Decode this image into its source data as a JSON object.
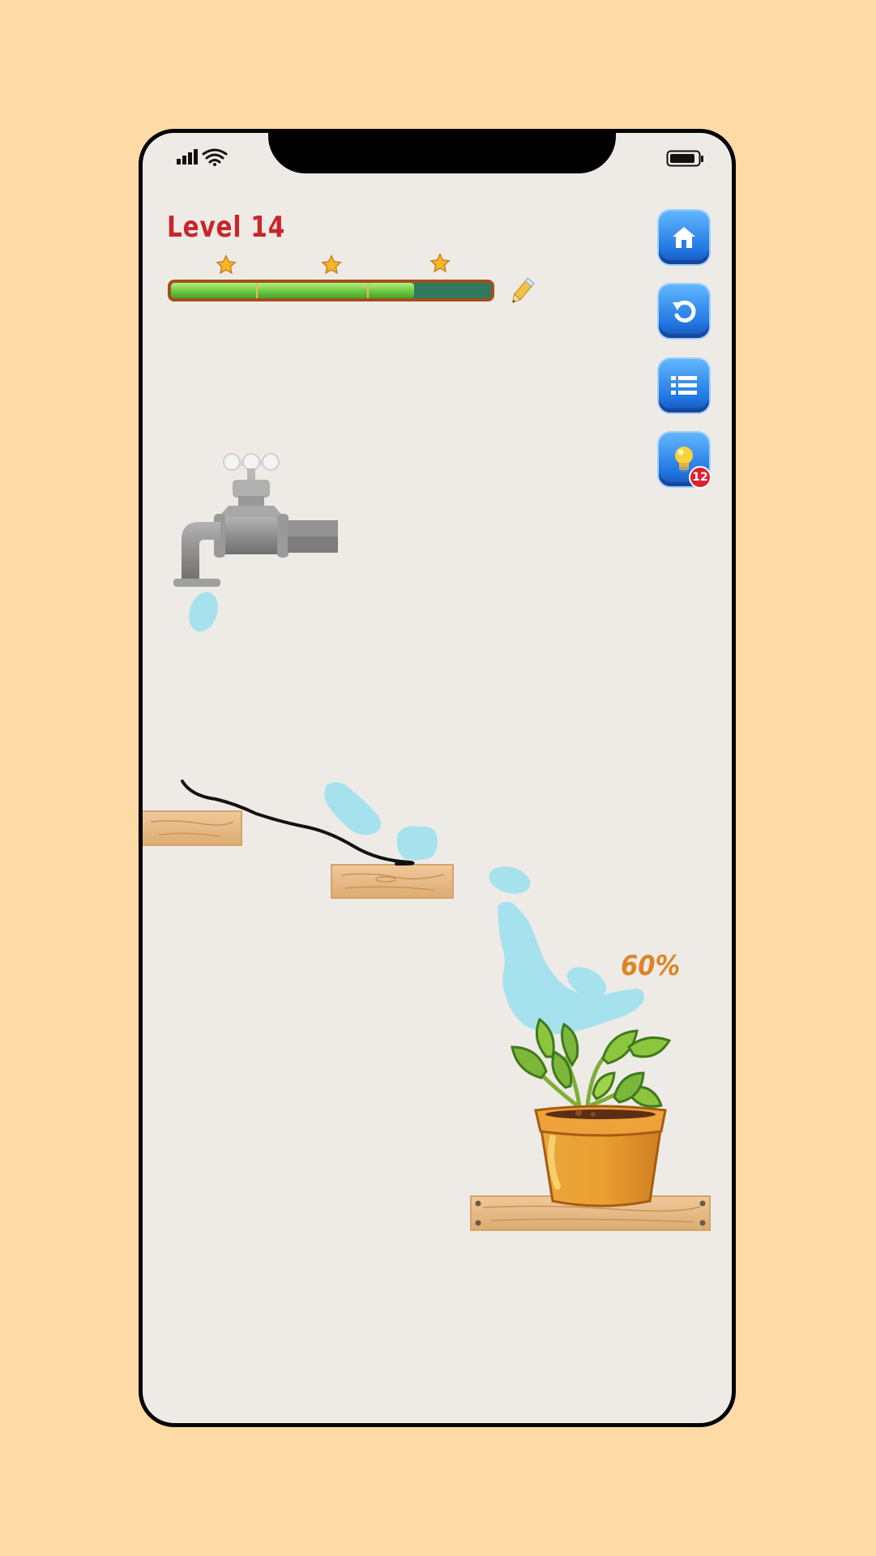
{
  "level": {
    "label": "Level 14"
  },
  "progress": {
    "fill_fraction": 0.76,
    "star_count": 3
  },
  "ink": {
    "pencil_icon": "pencil-icon"
  },
  "buttons": [
    {
      "name": "home-button",
      "icon": "home-icon"
    },
    {
      "name": "restart-button",
      "icon": "restart-icon"
    },
    {
      "name": "level-list-button",
      "icon": "list-icon"
    },
    {
      "name": "hint-button",
      "icon": "lightbulb-icon"
    }
  ],
  "hint": {
    "count": "12"
  },
  "fill": {
    "percent": "60%"
  },
  "colors": {
    "background": "#fedaa6",
    "screen": "#eeebe6",
    "level_text": "#c8262a",
    "water": "#a6e1ee",
    "percent_text": "#dc8528",
    "button_blue": "#1f74e0",
    "badge_red": "#de2130"
  }
}
